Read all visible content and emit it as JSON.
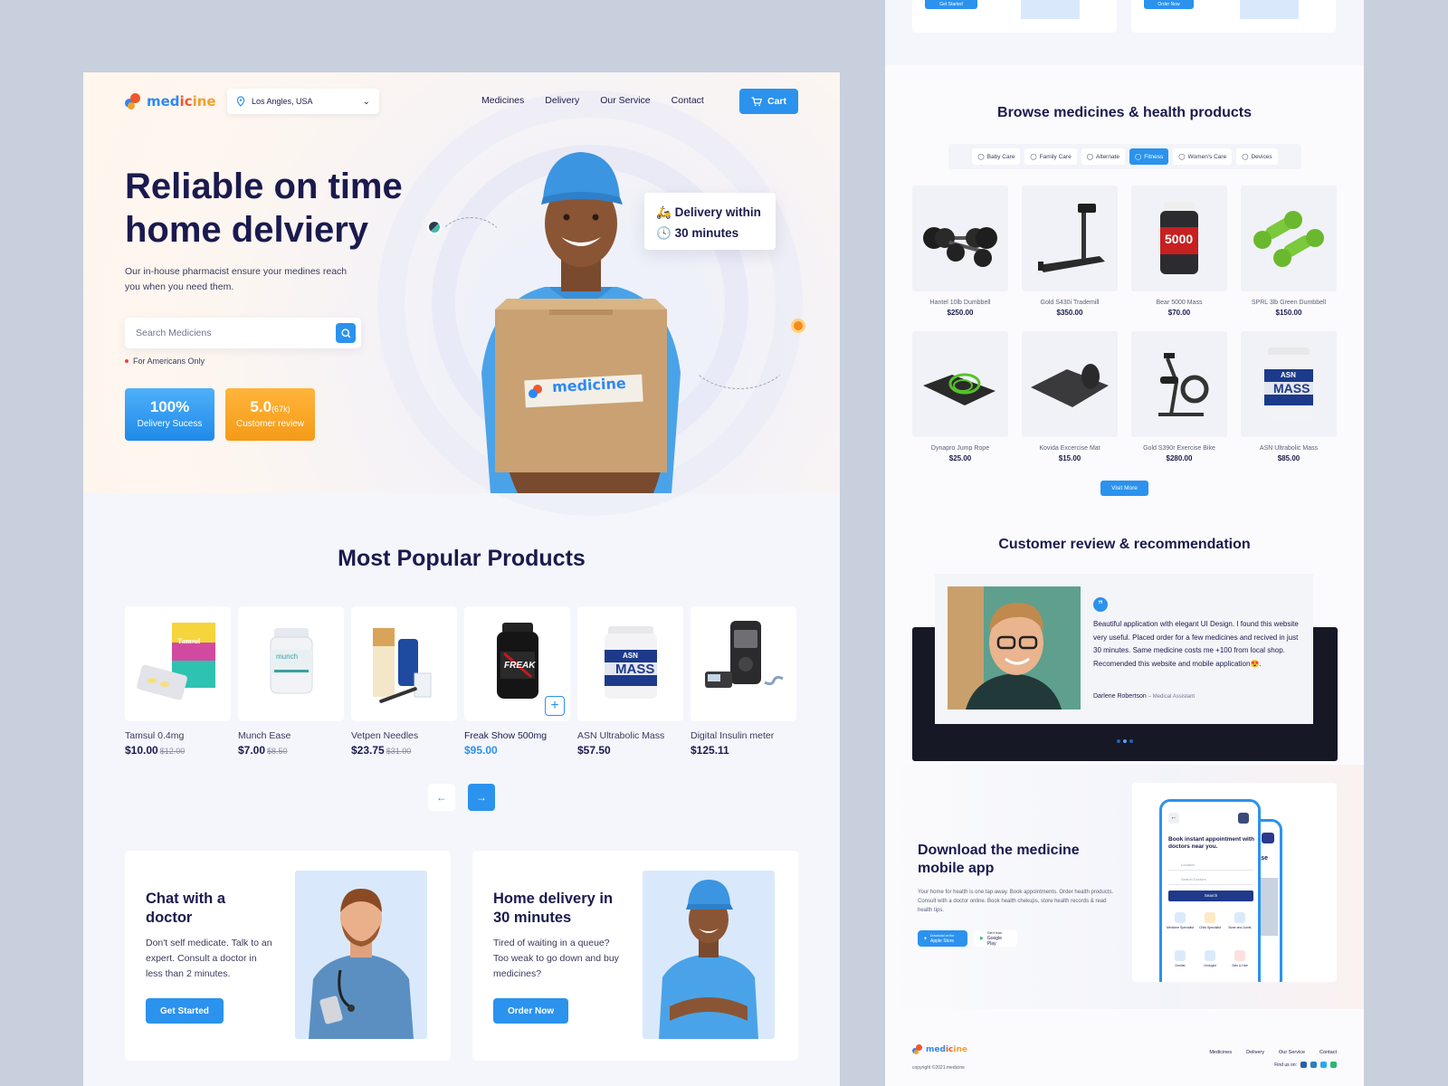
{
  "brand": {
    "name_parts": [
      "med",
      "ic",
      "ine"
    ],
    "name": "medicine"
  },
  "colors": {
    "primary": "#2b92ee",
    "orange": "#f59a18",
    "navy": "#1a1a4e",
    "bg": "#c8d0dd"
  },
  "header": {
    "location": "Los Angles, USA",
    "nav": [
      "Medicines",
      "Delivery",
      "Our Service",
      "Contact"
    ],
    "cart_label": "Cart"
  },
  "hero": {
    "title": "Reliable on time home delviery",
    "subtitle": "Our in-house pharmacist ensure your medines reach you when you need them.",
    "search_placeholder": "Search Mediciens",
    "note": "For Americans Only",
    "stats": [
      {
        "value": "100%",
        "extra": "",
        "label": "Delivery Sucess"
      },
      {
        "value": "5.0",
        "extra": "(67k)",
        "label": "Customer review"
      }
    ],
    "delivery_card": {
      "line1": "Delivery within",
      "line2": "30 minutes"
    },
    "box_brand": "medicine"
  },
  "popular": {
    "title": "Most Popular Products",
    "items": [
      {
        "name": "Tamsul 0.4mg",
        "price": "$10.00",
        "old": "$12.00"
      },
      {
        "name": "Munch Ease",
        "price": "$7.00",
        "old": "$8.50"
      },
      {
        "name": "Vetpen Needles",
        "price": "$23.75",
        "old": "$31.00"
      },
      {
        "name": "Freak Show 500mg",
        "price": "$95.00",
        "old": ""
      },
      {
        "name": "ASN Ultrabolic Mass",
        "price": "$57.50",
        "old": ""
      },
      {
        "name": "Digital Insulin meter",
        "price": "$125.11",
        "old": ""
      }
    ],
    "product_labels": {
      "tamsul": "Tamsul",
      "munch": "munch",
      "freak": "FREAK",
      "asn": "ASN",
      "mass": "MASS"
    }
  },
  "promos": [
    {
      "title": "Chat with a doctor",
      "text": "Don't self medicate. Talk to an expert. Consult a doctor in less than 2 minutes.",
      "button": "Get Started"
    },
    {
      "title": "Home delivery in 30 minutes",
      "text": "Tired of waiting in a queue? Too weak to go down and buy medicines?",
      "button": "Order Now"
    }
  ],
  "top_buttons": [
    "Get Started",
    "Order Now"
  ],
  "browse": {
    "title": "Browse medicines & health products",
    "tabs": [
      "Baby Care",
      "Family Care",
      "Alternate",
      "Fitness",
      "Women's Care",
      "Devices"
    ],
    "active_tab": "Fitness",
    "items": [
      {
        "name": "Hantel 10lb Dumbbell",
        "price": "$250.00"
      },
      {
        "name": "Gold S430i Trademill",
        "price": "$350.00"
      },
      {
        "name": "Bear 5000 Mass",
        "price": "$70.00"
      },
      {
        "name": "SPRL 3lb Green Dumbbell",
        "price": "$150.00"
      },
      {
        "name": "Dynapro Jump Rope",
        "price": "$25.00"
      },
      {
        "name": "Kovida Excercise Mat",
        "price": "$15.00"
      },
      {
        "name": "Gold S390r Exercise Bike",
        "price": "$280.00"
      },
      {
        "name": "ASN Ultrabolic Mass",
        "price": "$85.00"
      }
    ],
    "visit_more": "Visit More",
    "product_labels": {
      "bear": "5000",
      "asn": "ASN",
      "mass": "MASS"
    }
  },
  "review": {
    "title": "Customer review & recommendation",
    "quote_mark": "”",
    "text": "Beautiful application with elegant UI Design. I found this website very useful. Placed order for a few medicines and recived in just 30 minutes. Same medicine costs me +100 from local shop. Recomended this website and mobile application😍.",
    "author": "Darlene Robertson",
    "role": "– Medical Assistant"
  },
  "app": {
    "title": "Download the medicine mobile app",
    "text": "Your home for health is one tap away. Book appointments. Order health products. Consult with a doctor online. Book health chekups, store health records & read health tips.",
    "apple": {
      "small": "Download on the",
      "big": "Apple Store"
    },
    "google": {
      "small": "Get it from",
      "big": "Google Play"
    },
    "phone": {
      "heading": "Book instant appointment with doctors near you.",
      "location_ph": "Location",
      "search_ph": "Search Doctors",
      "search_btn": "Search",
      "categories": [
        "Medicine Specialist",
        "Child Specialist",
        "Bone and Joints",
        "Dentist",
        "Urologist",
        "Skin & Hair"
      ],
      "second_text": "to Release rus!"
    }
  },
  "footer": {
    "copyright": "copyright ©2021.medicine",
    "links": [
      "Medicines",
      "Delivery",
      "Our Service",
      "Contact"
    ],
    "find_us": "Find us on:"
  }
}
